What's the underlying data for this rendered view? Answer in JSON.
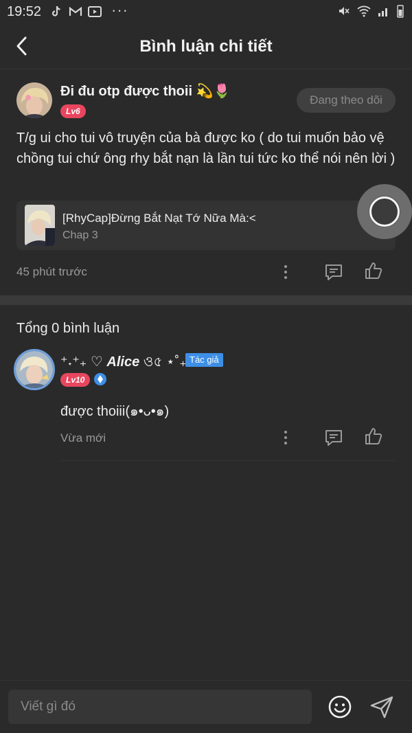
{
  "status_bar": {
    "time": "19:52",
    "dots": "···"
  },
  "header": {
    "title": "Bình luận chi tiết"
  },
  "post": {
    "author_name": "Đi đu otp được thoii 💫🌷",
    "level": "Lv6",
    "follow_label": "Đang theo dõi",
    "text": "T/g ui cho tui vô truyện của bà được ko ( do tui muốn bảo vệ chồng tui chứ ông rhy bắt nạn là lần tui tức ko thể nói nên lời )",
    "story": {
      "title": "[RhyCap]Đừng Bắt Nạt Tớ Nữa Mà:<",
      "chapter": "Chap 3"
    },
    "time": "45 phút trước"
  },
  "comments": {
    "total_label": "Tổng 0 bình luận",
    "items": [
      {
        "author_prefix": "⁺˖⁺₊ ♡",
        "author_name": "Alice",
        "author_suffix": "ও৫ ⋆˚₊°:",
        "tag": "Tác giả",
        "level": "Lv10",
        "text": "được thoiii(๑•ᴗ•๑)",
        "time": "Vừa mới"
      }
    ]
  },
  "input": {
    "placeholder": "Viết gì đó"
  },
  "colors": {
    "background": "#2a2a2a",
    "level_badge": "#e8465e",
    "author_tag": "#3d8fe6"
  }
}
